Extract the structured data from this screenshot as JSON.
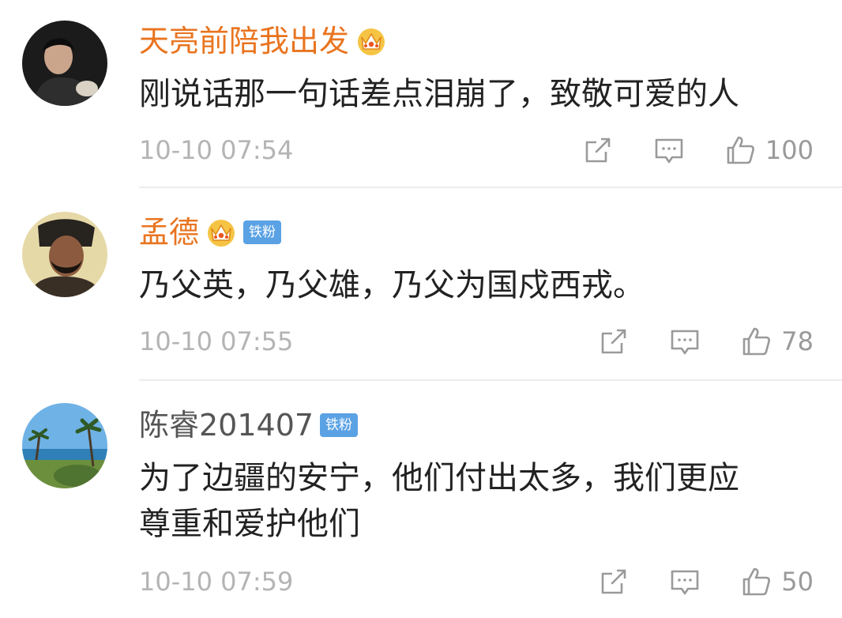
{
  "colors": {
    "username_vip": "#e9741f",
    "username_plain": "#555555",
    "fan_badge_bg": "#5aa2e4",
    "timestamp": "#b4b4b4",
    "icon": "#9a9a9a"
  },
  "comments": [
    {
      "username": "天亮前陪我出发",
      "has_crown": true,
      "badge": "",
      "text": "刚说话那一句话差点泪崩了，致敬可爱的人",
      "time": "10-10 07:54",
      "likes": "100",
      "icons": [
        "share-icon",
        "comment-icon",
        "like-icon"
      ]
    },
    {
      "username": "孟德",
      "has_crown": true,
      "badge": "铁粉",
      "text": "乃父英，乃父雄，乃父为国戍西戎。",
      "time": "10-10 07:55",
      "likes": "78",
      "icons": [
        "share-icon",
        "comment-icon",
        "like-icon"
      ]
    },
    {
      "username": "陈睿201407",
      "has_crown": false,
      "badge": "铁粉",
      "text": "为了边疆的安宁，他们付出太多，我们更应\n尊重和爱护他们",
      "time": "10-10 07:59",
      "likes": "50",
      "icons": [
        "share-icon",
        "comment-icon",
        "like-icon"
      ]
    }
  ]
}
